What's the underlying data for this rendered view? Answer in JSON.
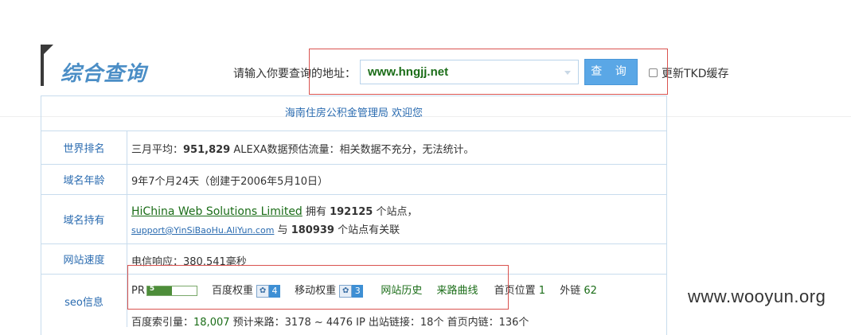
{
  "header": {
    "title": "综合查询",
    "query_label": "请输入你要查询的地址：",
    "url_value": "www.hngjj.net",
    "query_button": "查 询",
    "tkd_label": "更新TKD缓存"
  },
  "welcome": "海南住房公积金管理局 欢迎您",
  "rank": {
    "label": "世界排名",
    "prefix": "三月平均：",
    "value": "951,829",
    "suffix": " ALEXA数据预估流量：相关数据不充分，无法统计。"
  },
  "age": {
    "label": "域名年龄",
    "value": "9年7个月24天（创建于2006年5月10日）"
  },
  "owner": {
    "label": "域名持有",
    "company": "HiChina Web Solutions Limited",
    "own_prefix": " 拥有 ",
    "site_count": "192125",
    "own_suffix": " 个站点，",
    "email": "support@YinSiBaoHu.AliYun.com",
    "rel_prefix": " 与 ",
    "related_count": "180939",
    "rel_suffix": " 个站点有关联"
  },
  "speed": {
    "label": "网站速度",
    "value": "电信响应：380.541毫秒"
  },
  "seo": {
    "label": "seo信息",
    "pr_label": "PR",
    "pr_value": "5",
    "pr_level": 0.5,
    "baidu_weight_label": "百度权重",
    "baidu_weight": "4",
    "mobile_weight_label": "移动权重",
    "mobile_weight": "3",
    "history_link": "网站历史",
    "traffic_link": "来路曲线",
    "home_position_label": "首页位置",
    "home_position": "1",
    "outlinks_label": "外链",
    "outlinks": "62",
    "next_line_a": "百度索引量：",
    "baidu_index": "18,007",
    "next_line_b": "  预计来路：3178 ~ 4476 IP     出站链接：18个 首页内链：136个"
  },
  "watermark": "www.wooyun.org",
  "colors": {
    "accent": "#4b8ec6",
    "link_green": "#1b6d18",
    "highlight": "#d9534f"
  }
}
